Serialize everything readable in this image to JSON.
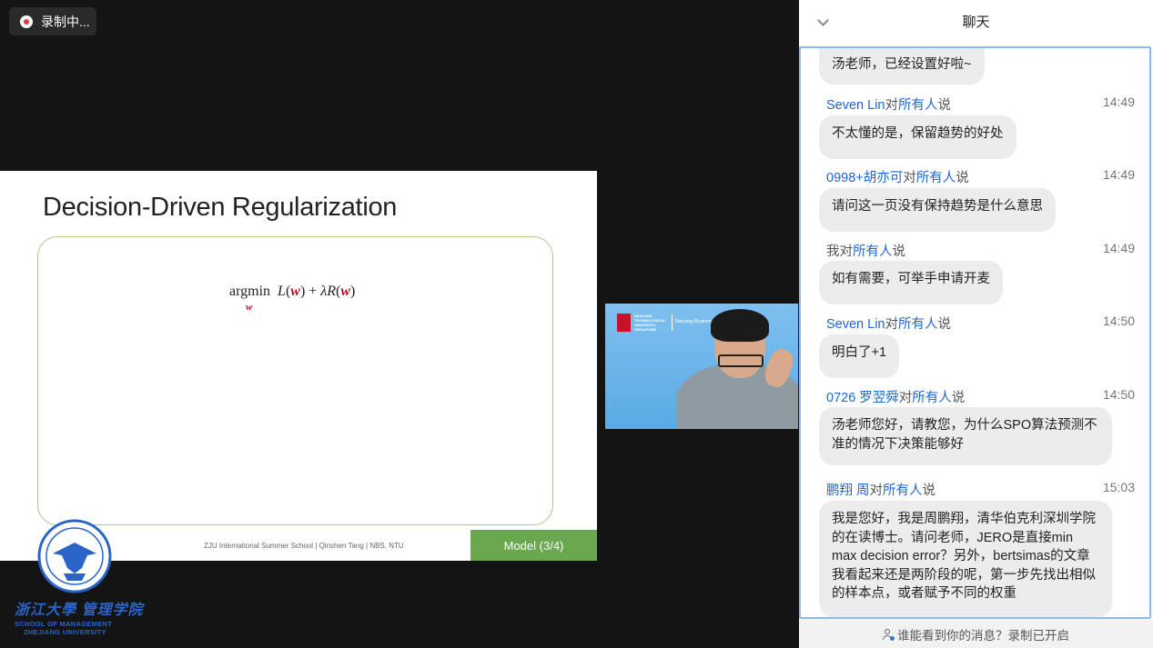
{
  "recording": {
    "label": "录制中..."
  },
  "slide": {
    "title": "Decision-Driven Regularization",
    "formula": {
      "op": "argmin",
      "sub": "w",
      "L": "L",
      "w": "w",
      "plus": "+",
      "lambda": "λ",
      "R": "R"
    },
    "footer": "ZJU International Summer School | Qinshen Tang | NBS, NTU",
    "section_tab": "Model (3/4)"
  },
  "logo": {
    "cn": "浙江大學 管理学院",
    "en1": "SCHOOL OF MANAGEMENT",
    "en2": "ZHEJIANG UNIVERSITY"
  },
  "video": {
    "ntu_text": "NANYANG TECHNOLOGICAL UNIVERSITY SINGAPORE",
    "nbs_text": "Nanyang Business Sc"
  },
  "chat": {
    "title": "聊天",
    "footer": "谁能看到你的消息？录制已开启",
    "to_word": "对",
    "target": "所有人",
    "say_word": "说",
    "top_bubble": "汤老师，已经设置好啦~",
    "messages": [
      {
        "sender": "Seven Lin",
        "time": "14:49",
        "text": "不太懂的是，保留趋势的好处"
      },
      {
        "sender": "0998+胡亦可",
        "time": "14:49",
        "text": "请问这一页没有保持趋势是什么意思"
      },
      {
        "sender": "我",
        "time": "14:49",
        "text": "如有需要，可举手申请开麦"
      },
      {
        "sender": "Seven Lin",
        "time": "14:50",
        "text": "明白了+1"
      },
      {
        "sender": "0726 罗翌舜",
        "time": "14:50",
        "text": "汤老师您好，请教您，为什么SPO算法预测不准的情况下决策能够好"
      },
      {
        "sender": "鹏翔 周",
        "time": "15:03",
        "text": "我是您好，我是周鹏翔，清华伯克利深圳学院的在读博士。请问老师，JERO是直接min max decision error？另外，bertsimas的文章我看起来还是两阶段的呢，第一步先找出相似的样本点，或者赋予不同的权重"
      }
    ]
  }
}
